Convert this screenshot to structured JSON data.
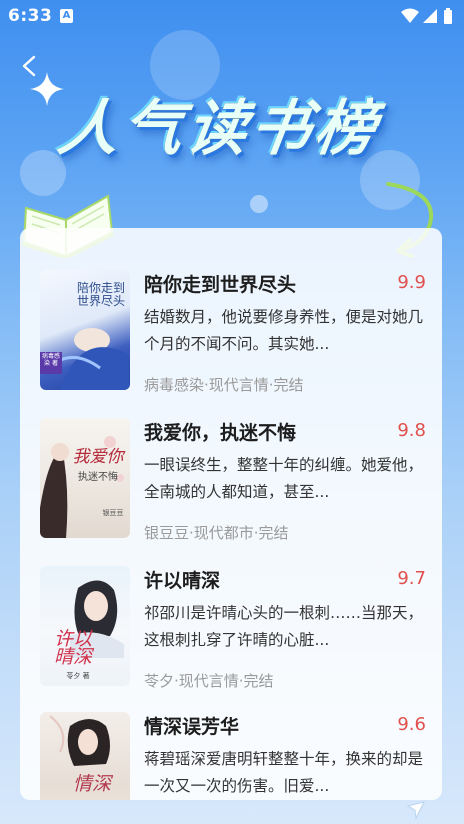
{
  "status_bar": {
    "time": "6:33",
    "a_badge": "A"
  },
  "header": {
    "title": "人气读书榜"
  },
  "books": [
    {
      "title": "陪你走到世界尽头",
      "score": "9.9",
      "description": "结婚数月，他说要修身养性，便是对她几个月的不闻不问。其实她...",
      "meta": "病毒感染·现代言情·完结",
      "cover_text": "陪你走到世界尽头",
      "cover_small": "病毒感染 著"
    },
    {
      "title": "我爱你，执迷不悔",
      "score": "9.8",
      "description": "一眼误终生，整整十年的纠缠。她爱他，全南城的人都知道，甚至...",
      "meta": "银豆豆·现代都市·完结",
      "cover_text": "我爱你",
      "cover_sub": "执迷不悔",
      "cover_small": "银豆豆"
    },
    {
      "title": "许以晴深",
      "score": "9.7",
      "description": "祁邵川是许晴心头的一根刺……当那天，这根刺扎穿了许晴的心脏...",
      "meta": "苓夕·现代言情·完结",
      "cover_text": "许以晴深",
      "cover_small": "苓夕 著"
    },
    {
      "title": "情深误芳华",
      "score": "9.6",
      "description": "蒋碧瑶深爱唐明轩整整十年，换来的却是一次又一次的伤害。旧爱...",
      "meta": "",
      "cover_text": "情深"
    }
  ],
  "colors": {
    "score": "#e0504c",
    "background_top": "#3f8ff0",
    "background_bottom": "#d7e8fb"
  }
}
